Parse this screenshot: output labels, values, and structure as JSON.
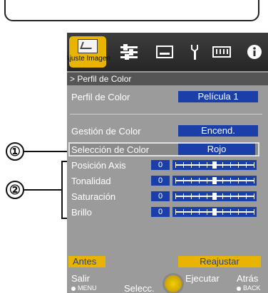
{
  "callouts": [
    "①",
    "②"
  ],
  "iconbar": {
    "active_label": "Ajuste Imagen",
    "icons": [
      "picture-icon",
      "slider-settings-icon",
      "display-icon",
      "wrench-icon",
      "keyboard-icon",
      "info-icon"
    ]
  },
  "breadcrumb": "> Perfil de Color",
  "rows": {
    "perfil": {
      "label": "Perfil de Color",
      "value": "Película 1"
    },
    "gestion": {
      "label": "Gestión de Color",
      "value": "Encend."
    },
    "seleccion": {
      "label": "Selección de Color",
      "value": "Rojo"
    }
  },
  "sliders": [
    {
      "label": "Posición Axis",
      "value": "0",
      "level": 0.5
    },
    {
      "label": "Tonalidad",
      "value": "0",
      "level": 0.5
    },
    {
      "label": "Saturación",
      "value": "0",
      "level": 0.5
    },
    {
      "label": "Brillo",
      "value": "0",
      "level": 0.5
    }
  ],
  "buttons": {
    "antes": "Antes",
    "reajustar": "Reajustar"
  },
  "footer": {
    "salir": "Salir",
    "menu": "MENU",
    "selecc": "Selecc.",
    "ejecutar": "Ejecutar",
    "atras": "Atrás",
    "back": "BACK"
  },
  "colors": {
    "accent": "#e8b400",
    "value_bg": "#1a3fa8",
    "panel": "#9b9b9b"
  }
}
